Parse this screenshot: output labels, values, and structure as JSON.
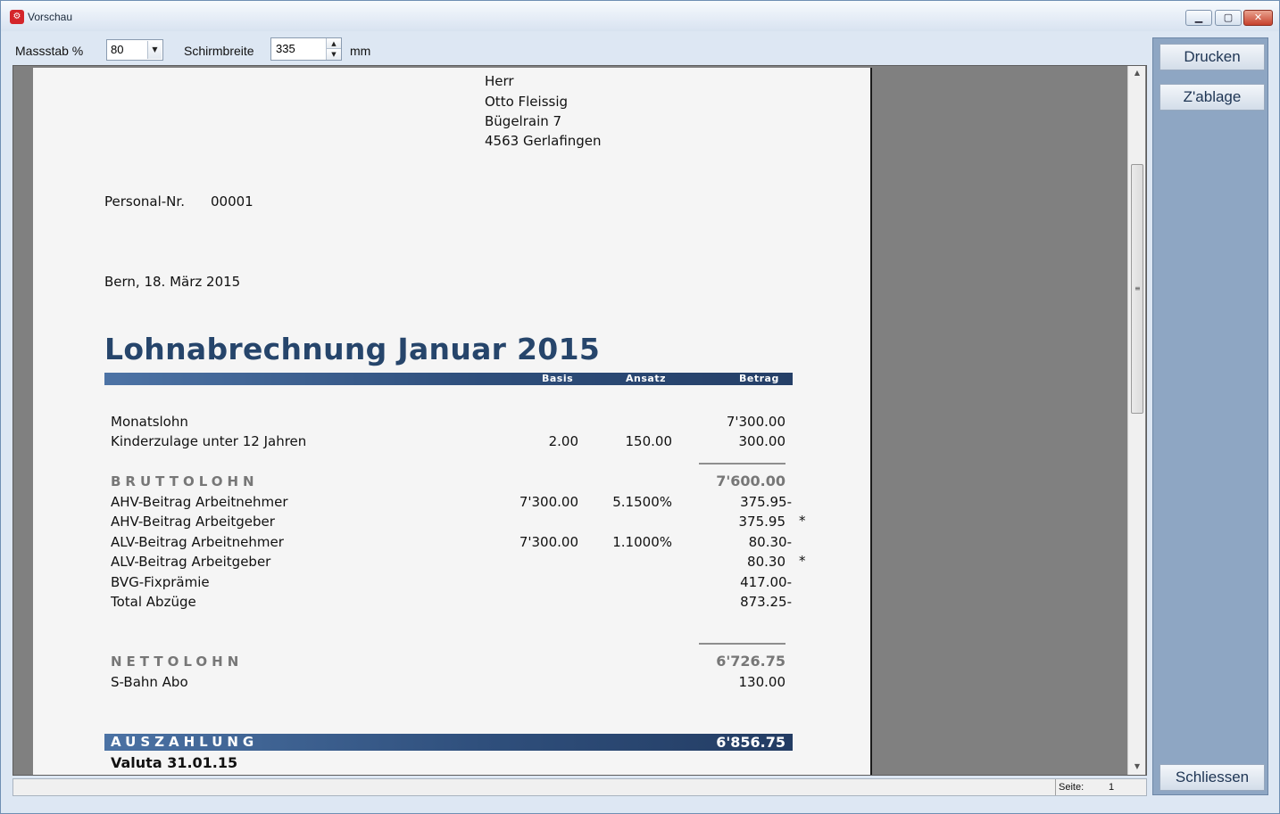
{
  "window": {
    "title": "Vorschau",
    "min_glyph": "▁",
    "max_glyph": "▢",
    "close_glyph": "✕"
  },
  "toolbar": {
    "scale_label": "Massstab %",
    "scale_value": "80",
    "screen_width_label": "Schirmbreite",
    "screen_width_value": "335",
    "unit_label": "mm"
  },
  "side": {
    "print_label": "Drucken",
    "clipboard_label": "Z'ablage",
    "close_label": "Schliessen"
  },
  "status": {
    "page_label": "Seite:",
    "page_value": "1"
  },
  "document": {
    "address": [
      "Herr",
      "Otto Fleissig",
      "Bügelrain 7",
      "4563 Gerlafingen"
    ],
    "personnel_label": "Personal-Nr.",
    "personnel_number": "00001",
    "date_line": "Bern, 18. März 2015",
    "title": "Lohnabrechnung Januar 2015",
    "columns": {
      "basis": "Basis",
      "ansatz": "Ansatz",
      "betrag": "Betrag"
    },
    "income": [
      {
        "label": "Monatslohn",
        "basis": "",
        "ansatz": "",
        "betrag": "7'300.00",
        "mark": ""
      },
      {
        "label": "Kinderzulage unter 12 Jahren",
        "basis": "2.00",
        "ansatz": "150.00",
        "betrag": "300.00",
        "mark": ""
      }
    ],
    "gross_label": "BRUTTOLOHN",
    "gross_value": "7'600.00",
    "deductions": [
      {
        "label": "AHV-Beitrag Arbeitnehmer",
        "basis": "7'300.00",
        "ansatz": "5.1500%",
        "betrag": "375.95-",
        "mark": ""
      },
      {
        "label": "AHV-Beitrag Arbeitgeber",
        "basis": "",
        "ansatz": "",
        "betrag": "375.95",
        "mark": "*"
      },
      {
        "label": "ALV-Beitrag Arbeitnehmer",
        "basis": "7'300.00",
        "ansatz": "1.1000%",
        "betrag": "80.30-",
        "mark": ""
      },
      {
        "label": "ALV-Beitrag Arbeitgeber",
        "basis": "",
        "ansatz": "",
        "betrag": "80.30",
        "mark": "*"
      },
      {
        "label": "BVG-Fixprämie",
        "basis": "",
        "ansatz": "",
        "betrag": "417.00-",
        "mark": ""
      },
      {
        "label": "Total Abzüge",
        "basis": "",
        "ansatz": "",
        "betrag": "873.25-",
        "mark": ""
      }
    ],
    "net_label": "NETTOLOHN",
    "net_value": "6'726.75",
    "extras": [
      {
        "label": "S-Bahn Abo",
        "betrag": "130.00"
      }
    ],
    "payout_label": "AUSZAHLUNG",
    "payout_value": "6'856.75",
    "valuta": "Valuta 31.01.15"
  }
}
